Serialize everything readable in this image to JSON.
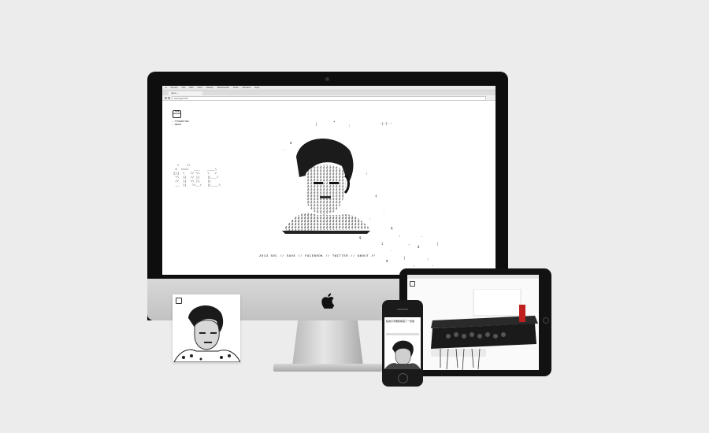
{
  "imac": {
    "menubar": [
      "Firefox",
      "File",
      "Edit",
      "View",
      "History",
      "Bookmarks",
      "Tools",
      "Window",
      "Help"
    ],
    "tab_title": "typer—",
    "url": "www.typer.hk",
    "site": {
      "logo_text": "TYPE\nWRITER",
      "nav": [
        "→ TYPEWRITER",
        "→ ABOUT"
      ],
      "top_right": "·[·]···",
      "ascii_art": "  \\    //\n 1  ====   ___    ____\\\n[|]  \\   // \\\\    \\   /\n \\\\  ||  // ||    ||___/\n //  ||  \\\\ ||    ||\n __  ||   \\\\__/   ||____\\",
      "bottom_links": "2013 SOC        //  SAVE  //  FACEBOOK  //  TWITTER  //  ABOUT  //"
    }
  },
  "phone": {
    "title": "私的打字機幫我寫了一封信"
  },
  "colors": {
    "background": "#ececec",
    "device_black": "#0e0e0e",
    "aluminium": "#c8c8c8"
  }
}
